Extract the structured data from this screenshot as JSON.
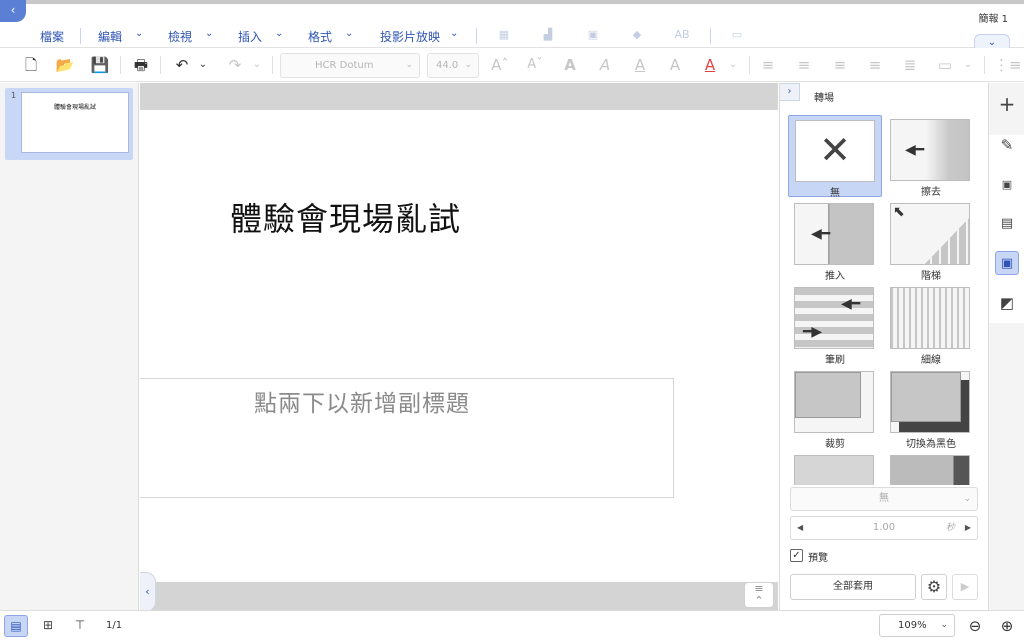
{
  "app": {
    "doc_title": "簡報 1"
  },
  "menu": {
    "items": [
      "檔案",
      "編輯",
      "檢視",
      "插入",
      "格式",
      "投影片放映"
    ]
  },
  "toolbar": {
    "font_name": "HCR Dotum",
    "font_size": "44.0"
  },
  "slides": [
    {
      "number": "1",
      "title": "體驗會現場亂試"
    }
  ],
  "slide": {
    "title": "體驗會現場亂試",
    "subtitle_placeholder": "點兩下以新增副標題"
  },
  "transition_panel": {
    "title": "轉場",
    "effects": [
      {
        "label": "無",
        "selected": true
      },
      {
        "label": "擦去",
        "selected": false
      },
      {
        "label": "推入",
        "selected": false
      },
      {
        "label": "階梯",
        "selected": false
      },
      {
        "label": "筆刷",
        "selected": false
      },
      {
        "label": "細線",
        "selected": false
      },
      {
        "label": "裁剪",
        "selected": false
      },
      {
        "label": "切換為黑色",
        "selected": false
      }
    ],
    "effect_option": "無",
    "duration_value": "1.00",
    "duration_unit": "秒",
    "preview_label": "預覽",
    "preview_checked": true,
    "apply_all_label": "全部套用"
  },
  "status": {
    "page_info": "1/1",
    "zoom": "109%"
  },
  "colors": {
    "accent": "#2e55b5",
    "selection": "#c8d6f6"
  }
}
